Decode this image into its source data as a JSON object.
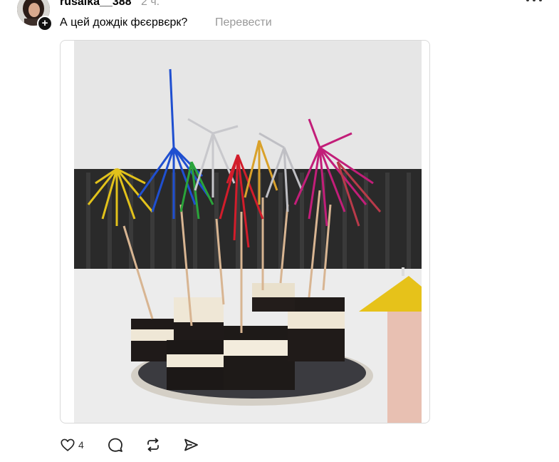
{
  "post": {
    "username": "rusalka__388",
    "timestamp": "2 ч.",
    "text": "А цей дождік фєєрвєрк?",
    "translate_label": "Перевести"
  },
  "media": {
    "alt": "Десерт Oreo с коктейльными шпажками-фейерверками"
  },
  "actions": {
    "like_count": "4"
  },
  "icons": {
    "more": "more-horizontal-icon",
    "follow": "plus-icon",
    "like": "heart-icon",
    "comment": "comment-bubble-icon",
    "repost": "repost-icon",
    "share": "send-icon"
  },
  "colors": {
    "secondary_text": "#999999",
    "border": "#d9d9d9"
  }
}
